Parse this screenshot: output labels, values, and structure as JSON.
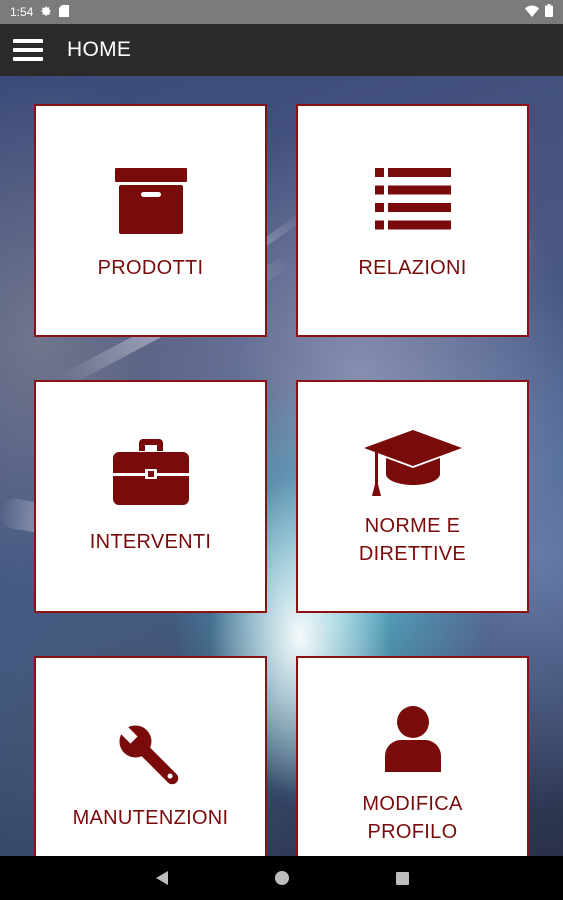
{
  "status_bar": {
    "time": "1:54",
    "icons": [
      "gear-icon",
      "sd-card-icon",
      "wifi-icon",
      "battery-icon"
    ]
  },
  "app_bar": {
    "title": "HOME",
    "menu_icon": "hamburger-menu-icon"
  },
  "colors": {
    "accent": "#7a0b0b",
    "tile_border": "#8c1111",
    "app_bar": "#2b2b2b",
    "status_bar": "#7b7b7b"
  },
  "tiles": [
    {
      "id": "prodotti",
      "label": "PRODOTTI",
      "icon": "archive-box-icon"
    },
    {
      "id": "relazioni",
      "label": "RELAZIONI",
      "icon": "list-icon"
    },
    {
      "id": "interventi",
      "label": "INTERVENTI",
      "icon": "briefcase-icon"
    },
    {
      "id": "norme",
      "label_line1": "NORME E",
      "label_line2": "DIRETTIVE",
      "icon": "graduation-cap-icon"
    },
    {
      "id": "manutenzioni",
      "label": "MANUTENZIONI",
      "icon": "wrench-icon"
    },
    {
      "id": "profilo",
      "label_line1": "MODIFICA",
      "label_line2": "PROFILO",
      "icon": "user-icon"
    }
  ],
  "nav_bar": {
    "buttons": [
      "back-icon",
      "home-icon",
      "recents-icon"
    ]
  }
}
